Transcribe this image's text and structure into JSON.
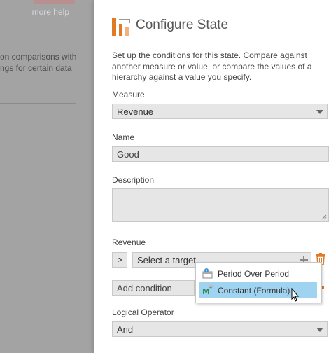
{
  "background": {
    "more_help": "more help",
    "text_line1": "on comparisons with",
    "text_line2": "ngs for certain data"
  },
  "panel": {
    "title": "Configure State",
    "intro": "Set up the conditions for this state. Compare against another measure or value, or compare the values of a hierarchy against a value you specify.",
    "measure": {
      "label": "Measure",
      "value": "Revenue"
    },
    "name": {
      "label": "Name",
      "value": "Good"
    },
    "description": {
      "label": "Description",
      "value": ""
    },
    "condition": {
      "label": "Revenue",
      "operator": ">",
      "target_placeholder": "Select a target"
    },
    "add_condition": "Add condition",
    "logical_operator": {
      "label": "Logical Operator",
      "value": "And"
    }
  },
  "target_menu": {
    "items": [
      {
        "label": "Period Over Period",
        "icon": "period-over-period-icon",
        "selected": false
      },
      {
        "label": "Constant (Formula)",
        "icon": "formula-icon",
        "selected": true
      }
    ]
  },
  "colors": {
    "accent_orange": "#e07a27",
    "selected_item": "#9fd3f0",
    "field_bg": "#e6e6e6",
    "overlay": "#a3a3a3"
  }
}
